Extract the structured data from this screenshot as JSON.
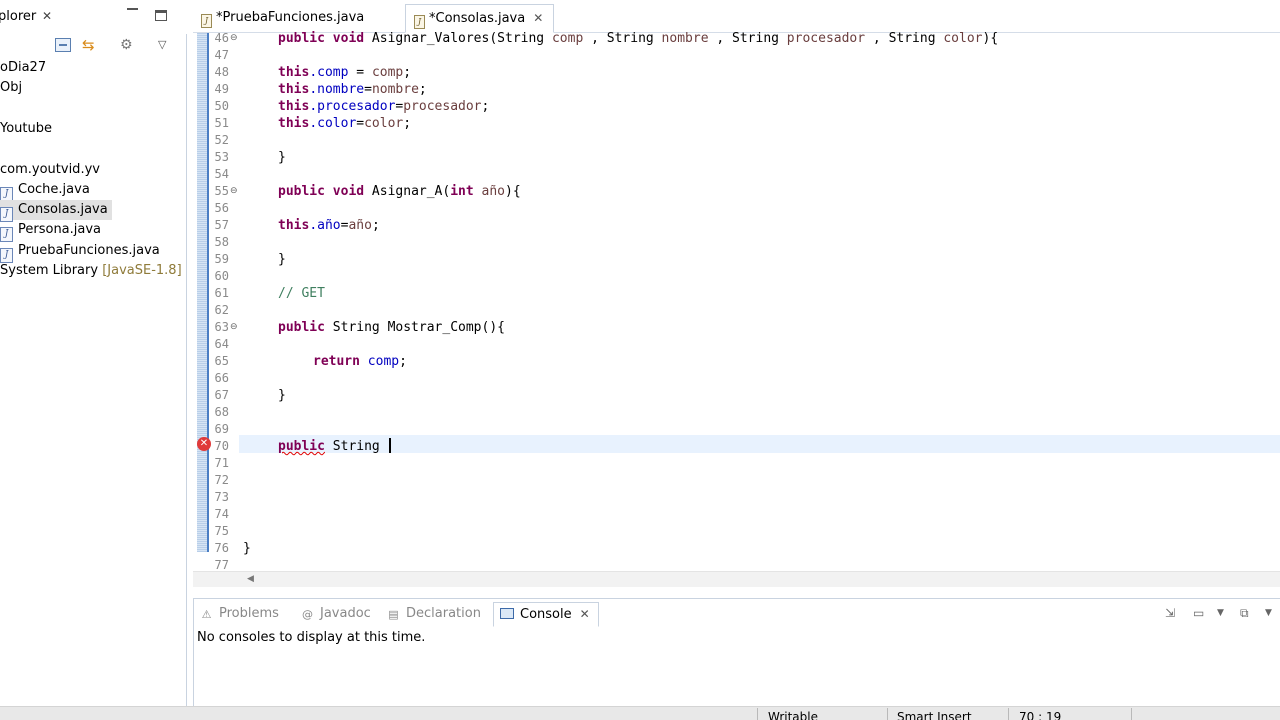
{
  "explorer": {
    "title": "plorer",
    "close": "✕",
    "items": [
      {
        "label": "oDia27",
        "icon": ""
      },
      {
        "label": "Obj",
        "icon": ""
      },
      {
        "label": "Youtube",
        "icon": ""
      },
      {
        "label": "com.youtvid.yv",
        "icon": ""
      },
      {
        "label": "Coche.java",
        "icon": "J"
      },
      {
        "label": "Consolas.java",
        "icon": "J"
      },
      {
        "label": "Persona.java",
        "icon": "J"
      },
      {
        "label": "PruebaFunciones.java",
        "icon": "J"
      },
      {
        "label": "System Library",
        "icon": ""
      }
    ],
    "jre": "[JavaSE-1.8]"
  },
  "editor_tabs": [
    {
      "label": "*PruebaFunciones.java",
      "icon": "J"
    },
    {
      "label": "*Consolas.java",
      "icon": "J",
      "close": "✕"
    }
  ],
  "editor": {
    "line_numbers": [
      "46",
      "47",
      "48",
      "49",
      "50",
      "51",
      "52",
      "53",
      "54",
      "55",
      "56",
      "57",
      "58",
      "59",
      "60",
      "61",
      "62",
      "63",
      "64",
      "65",
      "66",
      "67",
      "68",
      "69",
      "70",
      "71",
      "72",
      "73",
      "74",
      "75",
      "76",
      "77"
    ],
    "fold_marker": "⊖",
    "error_marker": "✕",
    "l46": {
      "kw1": "public",
      "kw2": "void",
      "m": " Asignar_Valores(",
      "t1": "String",
      "p1": " comp",
      "s1": " , ",
      "t2": "String",
      "p2": " nombre",
      "s2": " , ",
      "t3": "String",
      "p3": " procesador",
      "s3": " , ",
      "t4": "String",
      "p4": " color",
      "end": "){"
    },
    "l48": {
      "kw": "this",
      "f": ".comp",
      "r": " = ",
      "p": "comp",
      "e": ";"
    },
    "l49": {
      "kw": "this",
      "f": ".nombre",
      "r": "=",
      "p": "nombre",
      "e": ";"
    },
    "l50": {
      "kw": "this",
      "f": ".procesador",
      "r": "=",
      "p": "procesador",
      "e": ";"
    },
    "l51": {
      "kw": "this",
      "f": ".color",
      "r": "=",
      "p": "color",
      "e": ";"
    },
    "close_brace": "}",
    "l55": {
      "kw1": "public",
      "kw2": "void",
      "m": " Asignar_A(",
      "t": "int",
      "p": " año",
      "end": "){"
    },
    "l57": {
      "kw": "this",
      "f": ".año",
      "r": "=",
      "p": "año",
      "e": ";"
    },
    "l61": {
      "comment": "// GET"
    },
    "l63": {
      "kw": "public",
      "rest": " String Mostrar_Comp(){"
    },
    "l65": {
      "kw": "return",
      "f": " comp",
      "e": ";"
    },
    "l70": {
      "kw": "public",
      "rest": " String "
    },
    "l76": "}"
  },
  "bottom_panel": {
    "tabs": [
      {
        "label": "Problems",
        "icon": "⚠"
      },
      {
        "label": "Javadoc",
        "icon": "@"
      },
      {
        "label": "Declaration",
        "icon": "▤"
      },
      {
        "label": "Console",
        "icon": "",
        "close": "✕"
      }
    ],
    "message": "No consoles to display at this time."
  },
  "statusbar": {
    "writable": "Writable",
    "insert_mode": "Smart Insert",
    "position": "70 : 19"
  },
  "colors": {
    "keyword": "#7f0055",
    "field": "#0000c0",
    "comment": "#3f7f5f",
    "accent": "#4a7ec4"
  }
}
